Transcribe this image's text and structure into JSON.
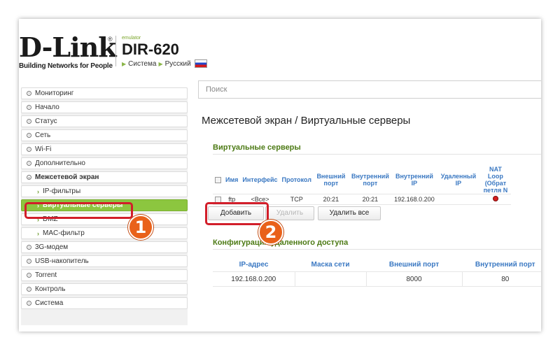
{
  "header": {
    "logo_text": "D-Link",
    "logo_reg": "®",
    "logo_tagline": "Building Networks for People",
    "emulator_label": "emulator",
    "model": "DIR-620",
    "crumb_system": "Система",
    "crumb_language": "Русский"
  },
  "sidebar": {
    "items": [
      {
        "label": "Мониторинг"
      },
      {
        "label": "Начало"
      },
      {
        "label": "Статус"
      },
      {
        "label": "Сеть"
      },
      {
        "label": "Wi-Fi"
      },
      {
        "label": "Дополнительно"
      },
      {
        "label": "Межсетевой экран"
      }
    ],
    "subitems": [
      {
        "label": "IP-фильтры"
      },
      {
        "label": "Виртуальные серверы"
      },
      {
        "label": "DMZ"
      },
      {
        "label": "MAC-фильтр"
      }
    ],
    "items_after": [
      {
        "label": "3G-модем"
      },
      {
        "label": "USB-накопитель"
      },
      {
        "label": "Torrent"
      },
      {
        "label": "Контроль"
      },
      {
        "label": "Система"
      }
    ]
  },
  "search": {
    "placeholder": "Поиск"
  },
  "page_title": "Межсетевой экран /  Виртуальные серверы",
  "virtual_servers": {
    "title": "Виртуальные серверы",
    "columns": [
      "Имя",
      "Интерфейс",
      "Протокол",
      "Внешний порт",
      "Внутренний порт",
      "Внутренний IP",
      "Удаленный IP",
      "NAT Loop (Обрат петля N"
    ],
    "rows": [
      {
        "name": "ftp",
        "interface": "<Все>",
        "protocol": "TCP",
        "ext_port": "20:21",
        "int_port": "20:21",
        "int_ip": "192.168.0.200",
        "remote_ip": "",
        "nat_loopback": "off"
      }
    ],
    "buttons": {
      "add": "Добавить",
      "delete": "Удалить",
      "delete_all": "Удалить все"
    }
  },
  "remote_access": {
    "title": "Конфигурация удаленного доступа",
    "columns": [
      "IP-адрес",
      "Маска сети",
      "Внешний порт",
      "Внутренний порт"
    ],
    "rows": [
      {
        "ip": "192.168.0.200",
        "mask": "",
        "ext_port": "8000",
        "int_port": "80"
      }
    ]
  },
  "callouts": {
    "one": "1",
    "two": "2"
  },
  "colors": {
    "accent_green": "#8cc63f",
    "link_blue": "#3a78c2",
    "callout_red": "#d21e2a",
    "badge_orange": "#e9611a"
  }
}
